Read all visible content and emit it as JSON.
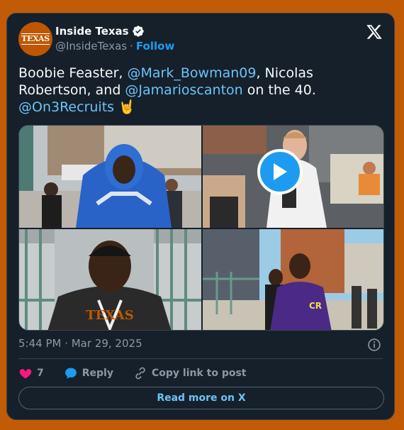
{
  "author": {
    "avatar_wordmark": "TEXAS",
    "display_name": "Inside Texas",
    "handle": "@InsideTexas",
    "separator": "·",
    "follow_label": "Follow",
    "verified": true
  },
  "tweet": {
    "parts": [
      {
        "text": "Boobie Feaster, ",
        "mention": false
      },
      {
        "text": "@Mark_Bowman09",
        "mention": true
      },
      {
        "text": ", Nicolas Robertson, and ",
        "mention": false
      },
      {
        "text": "@Jamarioscanton",
        "mention": true
      },
      {
        "text": " on the 40. ",
        "mention": false
      },
      {
        "text": "@On3Recruits",
        "mention": true
      },
      {
        "text": " 🤘",
        "mention": false
      }
    ],
    "timestamp": "5:44 PM · Mar 29, 2025"
  },
  "media": {
    "tiles": [
      {
        "name": "video-tile-blue-hoodie"
      },
      {
        "name": "video-tile-white-shirt"
      },
      {
        "name": "video-tile-texas-hoodie"
      },
      {
        "name": "video-tile-purple-shirt"
      }
    ]
  },
  "actions": {
    "like_count": "7",
    "reply_label": "Reply",
    "copy_link_label": "Copy link to post"
  },
  "footer": {
    "read_more_label": "Read more on X"
  },
  "colors": {
    "page_bg": "#c25b06",
    "card_bg": "#15202b",
    "accent": "#1d9bf0",
    "mention": "#6cc3f7",
    "like": "#f91880",
    "brand_orange": "#bf5700"
  }
}
